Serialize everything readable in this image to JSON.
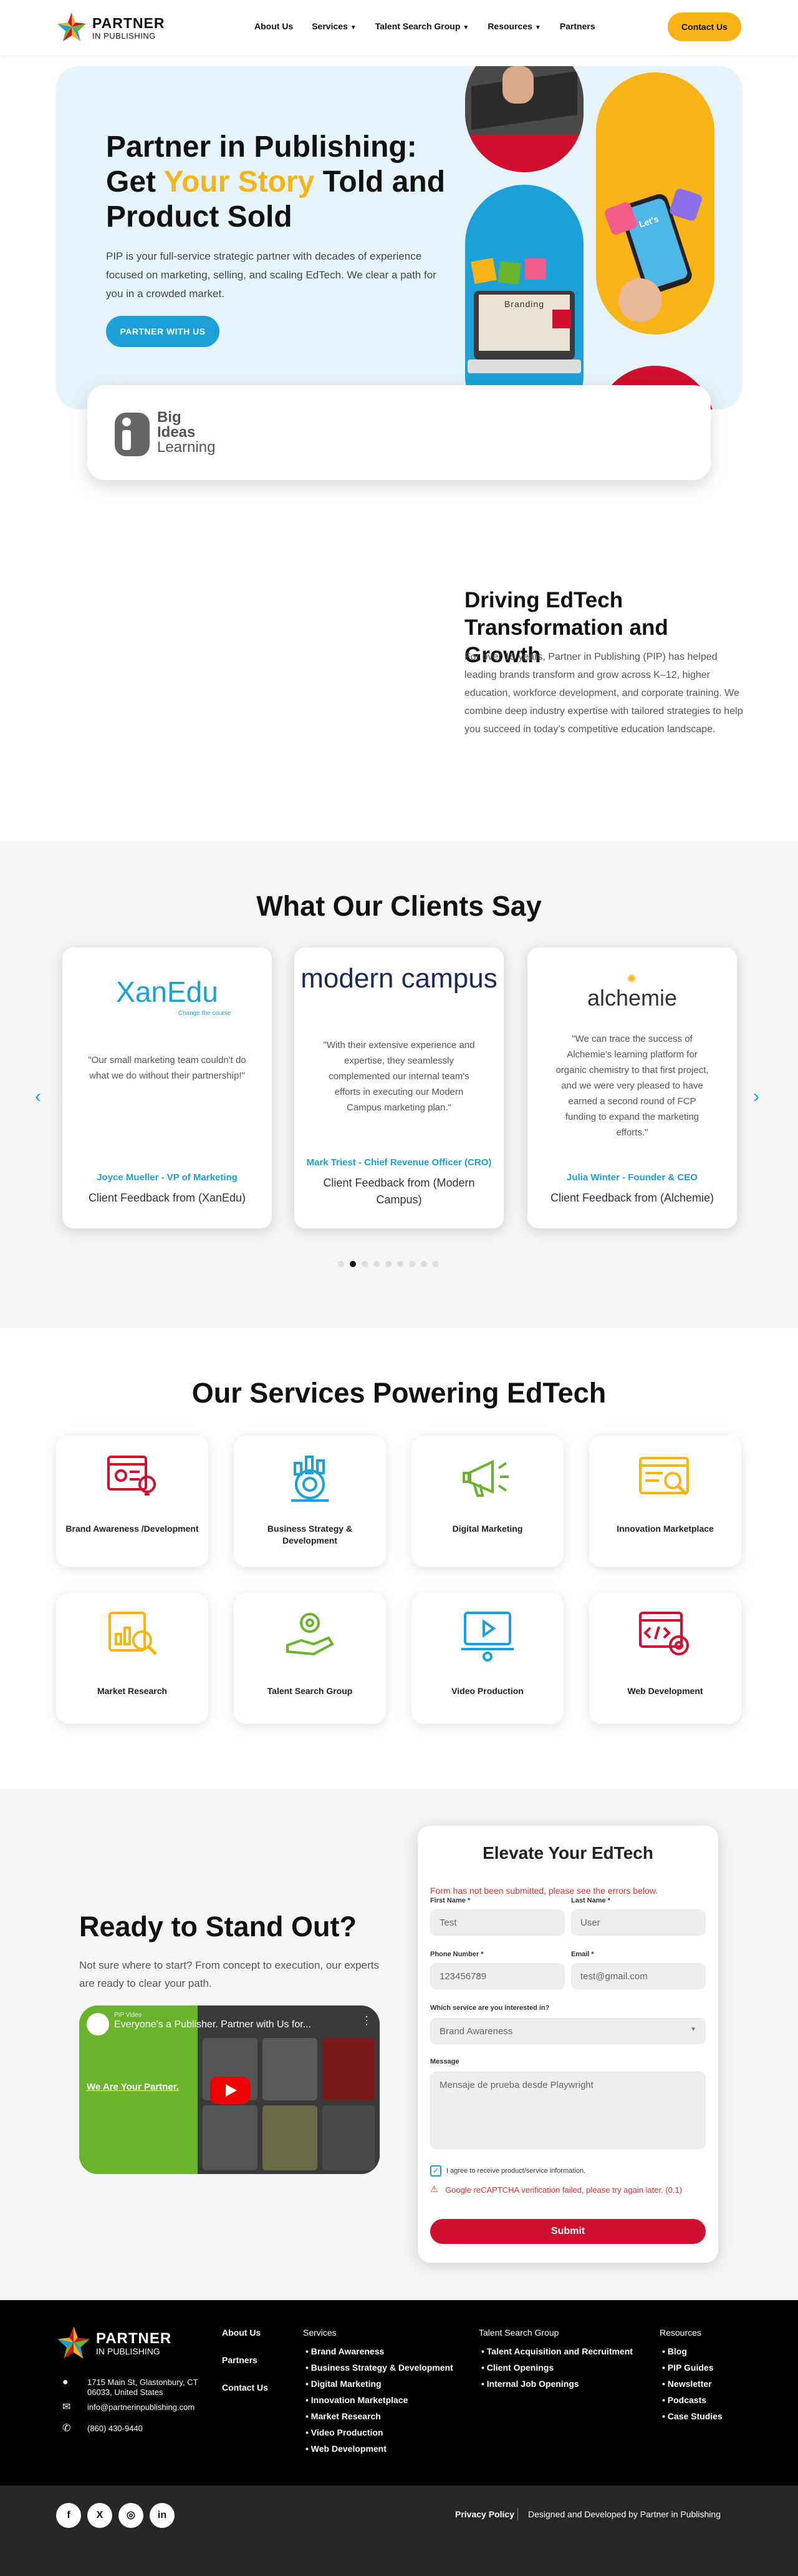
{
  "header": {
    "logo_line1": "PARTNER",
    "logo_line2": "IN PUBLISHING",
    "nav": [
      {
        "label": "About Us",
        "dropdown": false
      },
      {
        "label": "Services",
        "dropdown": true
      },
      {
        "label": "Talent Search Group",
        "dropdown": true
      },
      {
        "label": "Resources",
        "dropdown": true
      },
      {
        "label": "Partners",
        "dropdown": false
      }
    ],
    "contact_label": "Contact Us"
  },
  "hero": {
    "title_pre": "Partner in Publishing: Get ",
    "title_highlight": "Your Story",
    "title_post": " Told and Product Sold",
    "subtitle": "PIP is your full-service strategic partner with decades of experience focused on marketing, selling, and scaling EdTech. We clear a path for you in a crowded market.",
    "cta_label": "PARTNER WITH US",
    "laptop_screen_text": "Branding",
    "phone_screen_text": "Let's"
  },
  "logo_strip": {
    "line1": "Big",
    "line2": "Ideas",
    "line3": "Learning"
  },
  "driving": {
    "title": "Driving EdTech Transformation and Growth",
    "body": "For over 15 years, Partner in Publishing (PIP) has helped leading brands transform and grow across K–12, higher education, workforce development, and corporate training. We combine deep industry expertise with tailored strategies to help you succeed in today's competitive education landscape."
  },
  "testimonials": {
    "title": "What Our Clients Say",
    "cards": [
      {
        "logo": "XanEdu",
        "logo_tag": "Change the course",
        "quote": "\"Our small marketing team couldn't do what we do without their partnership!\"",
        "name": "Joyce Mueller - VP of Marketing",
        "source": "Client Feedback from (XanEdu)"
      },
      {
        "logo": "modern campus",
        "quote": "\"With their extensive experience and expertise, they seamlessly complemented our internal team's efforts in executing our Modern Campus marketing plan.\"",
        "name": "Mark Triest - Chief Revenue Officer (CRO)",
        "source": "Client Feedback from (Modern Campus)"
      },
      {
        "logo": "alchemie",
        "quote": "\"We can trace the success of Alchemie's learning platform for organic chemistry to that first project, and we were very pleased to have earned a second round of FCP funding to expand the marketing efforts.\"",
        "name": "Julia Winter - Founder & CEO",
        "source": "Client Feedback from (Alchemie)"
      }
    ],
    "prev_icon": "chevron-left-icon",
    "next_icon": "chevron-right-icon",
    "dot_count": 9,
    "active_dot": 2
  },
  "services": {
    "title": "Our Services Powering EdTech",
    "items": [
      {
        "label": "Brand Awareness /Development",
        "icon": "brand-icon",
        "color": "#d10f2f"
      },
      {
        "label": "Business Strategy & Development",
        "icon": "strategy-icon",
        "color": "#1ba1d8"
      },
      {
        "label": "Digital Marketing",
        "icon": "megaphone-icon",
        "color": "#6ab42d"
      },
      {
        "label": "Innovation Marketplace",
        "icon": "browser-search-icon",
        "color": "#f8b416"
      },
      {
        "label": "Market Research",
        "icon": "research-icon",
        "color": "#f8b416"
      },
      {
        "label": "Talent Search Group",
        "icon": "talent-icon",
        "color": "#6ab42d"
      },
      {
        "label": "Video Production",
        "icon": "video-icon",
        "color": "#1ba1d8"
      },
      {
        "label": "Web Development",
        "icon": "web-dev-icon",
        "color": "#d10f2f"
      }
    ]
  },
  "cta": {
    "title": "Ready to Stand Out?",
    "body": "Not sure where to start? From concept to execution, our experts are ready to clear your path.",
    "video_title": "Everyone's a Publisher. Partner with Us for...",
    "video_channel": "PIP Video",
    "video_overlay": "We Are Your Partner."
  },
  "form": {
    "title": "Elevate Your EdTech",
    "error": "Form has not been submitted, please see the errors below.",
    "first_name_label": "First Name *",
    "first_name_value": "Test",
    "last_name_label": "Last Name *",
    "last_name_value": "User",
    "phone_label": "Phone Number *",
    "phone_value": "123456789",
    "email_label": "Email *",
    "email_value": "test@gmail.com",
    "service_label": "Which service are you interested in?",
    "service_value": "Brand Awareness",
    "message_label": "Message",
    "message_value": "Mensaje de prueba desde Playwright",
    "consent_label": "I agree to receive product/service information.",
    "captcha_error": "Google reCAPTCHA verification failed, please try again later. (0.1)",
    "submit_label": "Submit"
  },
  "footer": {
    "address": "1715 Main St, Glastonbury, CT 06033, United States",
    "email": "info@partnerinpublishing.com",
    "phone": "(860) 430-9440",
    "nav": [
      "About Us",
      "Partners",
      "Contact Us"
    ],
    "services_heading": "Services",
    "services": [
      "Brand Awareness",
      "Business Strategy & Development",
      "Digital Marketing",
      "Innovation Marketplace",
      "Market Research",
      "Video Production",
      "Web Development"
    ],
    "talent_heading": "Talent Search Group",
    "talent": [
      "Talent Acquisition and Recruitment",
      "Client Openings",
      "Internal Job Openings"
    ],
    "resources_heading": "Resources",
    "resources": [
      "Blog",
      "PIP Guides",
      "Newsletter",
      "Podcasts",
      "Case Studies"
    ],
    "social": [
      {
        "icon": "facebook-icon",
        "glyph": "f"
      },
      {
        "icon": "x-icon",
        "glyph": "X"
      },
      {
        "icon": "instagram-icon",
        "glyph": "◎"
      },
      {
        "icon": "linkedin-icon",
        "glyph": "in"
      }
    ],
    "privacy": "Privacy Policy",
    "credit": "Designed and Developed by Partner in Publishing"
  },
  "colors": {
    "accent_yellow": "#f8b416",
    "accent_blue": "#1ba1d8",
    "accent_red": "#d10f2f",
    "accent_green": "#6ab42d"
  }
}
